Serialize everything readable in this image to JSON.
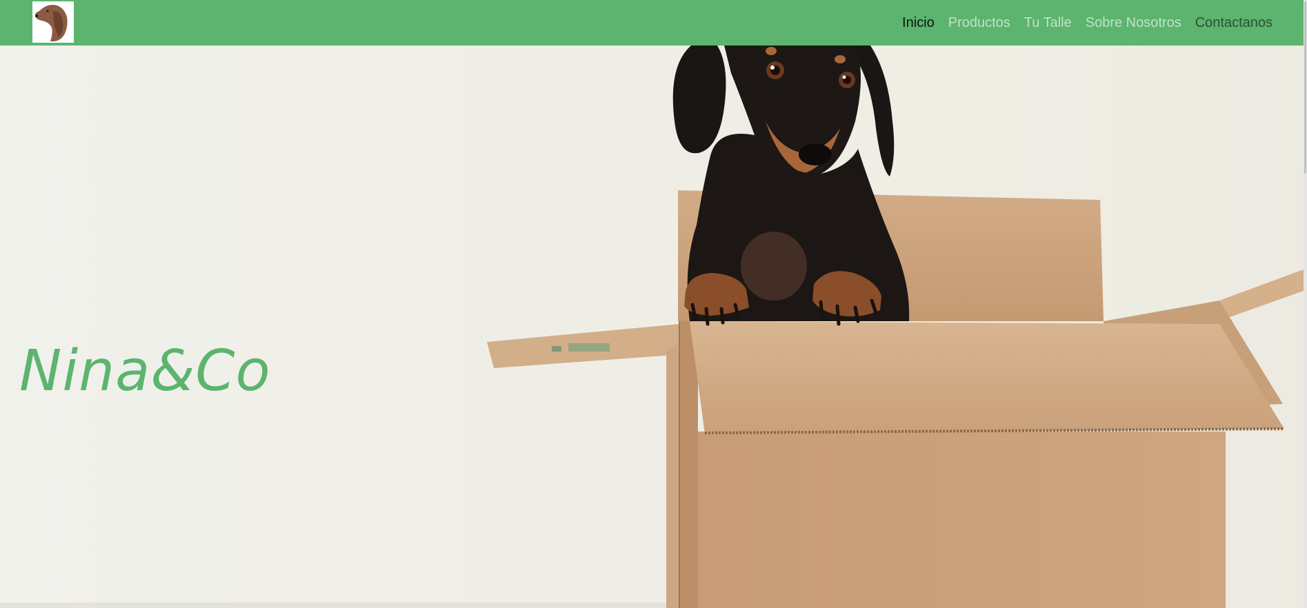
{
  "header": {
    "logo_icon": "dachshund-head-icon",
    "nav": [
      {
        "label": "Inicio",
        "state": "active"
      },
      {
        "label": "Productos",
        "state": "default"
      },
      {
        "label": "Tu Talle",
        "state": "default"
      },
      {
        "label": "Sobre Nosotros",
        "state": "default"
      },
      {
        "label": "Contactanos",
        "state": "dark"
      }
    ]
  },
  "hero": {
    "title": "Nina&Co",
    "image": "dog-in-cardboard-box"
  },
  "colors": {
    "brand_green": "#5cb46e",
    "background": "#f0efe8",
    "cardboard": "#c9a07a",
    "dog_black": "#1a1614",
    "dog_tan": "#a9663a"
  }
}
